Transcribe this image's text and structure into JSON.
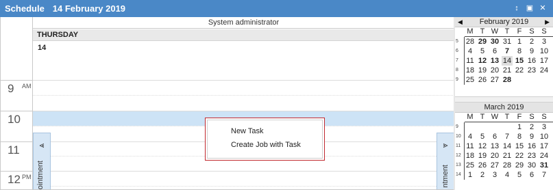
{
  "window": {
    "title": "Schedule",
    "date": "14 February 2019",
    "controls": [
      "↕",
      "▣",
      "✕"
    ]
  },
  "resource": "System administrator",
  "day": {
    "name": "THURSDAY",
    "number": "14"
  },
  "hours": [
    {
      "h": "9",
      "ampm": "AM"
    },
    {
      "h": "10",
      "ampm": ""
    },
    {
      "h": "11",
      "ampm": ""
    },
    {
      "h": "12",
      "ampm": "PM"
    }
  ],
  "side_tabs": {
    "left_arrow": "⪡",
    "left_text": "ointment",
    "right_arrow": "⪢",
    "right_text": "ntment"
  },
  "context_menu": [
    "New Task",
    "Create Job with Task"
  ],
  "calendars": [
    {
      "title": "February 2019",
      "prev": "◀",
      "next": "▶",
      "dow": [
        "M",
        "T",
        "W",
        "T",
        "F",
        "S",
        "S"
      ],
      "weeks": [
        {
          "wk": "5",
          "days": [
            "28",
            "29",
            "30",
            "31",
            "1",
            "2",
            "3"
          ],
          "bold": [
            1,
            2
          ]
        },
        {
          "wk": "6",
          "days": [
            "4",
            "5",
            "6",
            "7",
            "8",
            "9",
            "10"
          ],
          "bold": [
            3
          ]
        },
        {
          "wk": "7",
          "days": [
            "11",
            "12",
            "13",
            "14",
            "15",
            "16",
            "17"
          ],
          "bold": [
            1,
            2,
            4
          ],
          "today": 3
        },
        {
          "wk": "8",
          "days": [
            "18",
            "19",
            "20",
            "21",
            "22",
            "23",
            "24"
          ],
          "bold": []
        },
        {
          "wk": "9",
          "days": [
            "25",
            "26",
            "27",
            "28",
            "",
            "",
            ""
          ],
          "bold": [
            3
          ]
        }
      ]
    },
    {
      "title": "March 2019",
      "dow": [
        "M",
        "T",
        "W",
        "T",
        "F",
        "S",
        "S"
      ],
      "weeks": [
        {
          "wk": "9",
          "days": [
            "",
            "",
            "",
            "",
            "1",
            "2",
            "3"
          ],
          "bold": []
        },
        {
          "wk": "10",
          "days": [
            "4",
            "5",
            "6",
            "7",
            "8",
            "9",
            "10"
          ],
          "bold": []
        },
        {
          "wk": "11",
          "days": [
            "11",
            "12",
            "13",
            "14",
            "15",
            "16",
            "17"
          ],
          "bold": []
        },
        {
          "wk": "12",
          "days": [
            "18",
            "19",
            "20",
            "21",
            "22",
            "23",
            "24"
          ],
          "bold": []
        },
        {
          "wk": "13",
          "days": [
            "25",
            "26",
            "27",
            "28",
            "29",
            "30",
            "31"
          ],
          "bold": [
            6
          ]
        },
        {
          "wk": "14",
          "days": [
            "1",
            "2",
            "3",
            "4",
            "5",
            "6",
            "7"
          ],
          "bold": []
        }
      ]
    }
  ]
}
